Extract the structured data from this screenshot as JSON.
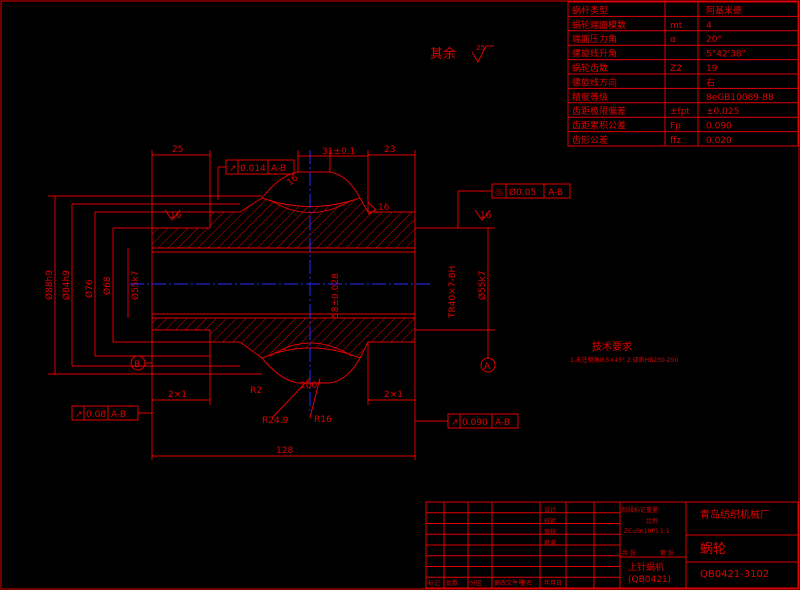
{
  "param_table": {
    "rows": [
      {
        "name": "蜗杆类型",
        "symbol": "",
        "value": "阿基米德"
      },
      {
        "name": "蜗轮端面模数",
        "symbol": "mt",
        "value": "4"
      },
      {
        "name": "端面压力角",
        "symbol": "α",
        "value": "20°"
      },
      {
        "name": "螺旋线升角",
        "symbol": "",
        "value": "5°42'38\""
      },
      {
        "name": "蜗轮齿数",
        "symbol": "Z2",
        "value": "19"
      },
      {
        "name": "螺旋线方向",
        "symbol": "",
        "value": "右"
      },
      {
        "name": "精度等级",
        "symbol": "",
        "value": "8eGB10089-88"
      },
      {
        "name": "齿距极限偏差",
        "symbol": "±fpt",
        "value": "±0.025"
      },
      {
        "name": "齿距累积公差",
        "symbol": "Fp",
        "value": "0.090"
      },
      {
        "name": "齿形公差",
        "symbol": "ffz",
        "value": "0.020"
      }
    ]
  },
  "roughness_note": "其余",
  "roughness_value": "25",
  "dims": {
    "d25": "25",
    "d3140": "31±0.1",
    "d23": "23",
    "d128": "128",
    "d2x1a": "2×1",
    "d2x1b": "2×1",
    "d88": "Ø88h9",
    "d84": "Ø84h9",
    "d76": "Ø76",
    "d68": "Ø68",
    "d557a": "Ø55k7",
    "d557b": "Ø55k7",
    "d58": "58±0.028",
    "tr": "TR40×7-8H",
    "r2": "R2",
    "r249": "R24.9",
    "r16": "R16",
    "a100": "100°",
    "t16": "16",
    "r16b": "16",
    "r16c": "16",
    "r16d": "16"
  },
  "tolerances": {
    "runout1": {
      "value": "0.014",
      "datum": "A-B"
    },
    "coax": {
      "value": "Ø0.05",
      "datum": "A-B"
    },
    "runout2": {
      "value": "0.08",
      "datum": "A-B"
    },
    "runout3": {
      "value": "0.090",
      "datum": "A-B"
    }
  },
  "datums": {
    "a": "A",
    "b": "B"
  },
  "tech_req": {
    "title": "技术要求",
    "line1": "1.未注倒角0.5×45°  2.调质HB230-250"
  },
  "title_block": {
    "company": "青岛纺织机械厂",
    "part_name": "蜗轮",
    "drawing_no": "QB0421-3102",
    "assembly": "上针蜗机",
    "assembly_code": "(QB0421)",
    "material_label": "ZCuSn10P1",
    "scale_label": "1:1",
    "labels": [
      "设计",
      "校对",
      "审核",
      "批准",
      "标记",
      "处数",
      "分区",
      "更改文件号",
      "签名",
      "年月日",
      "阶段标记",
      "重量",
      "比例",
      "共 张",
      "第 张"
    ]
  }
}
